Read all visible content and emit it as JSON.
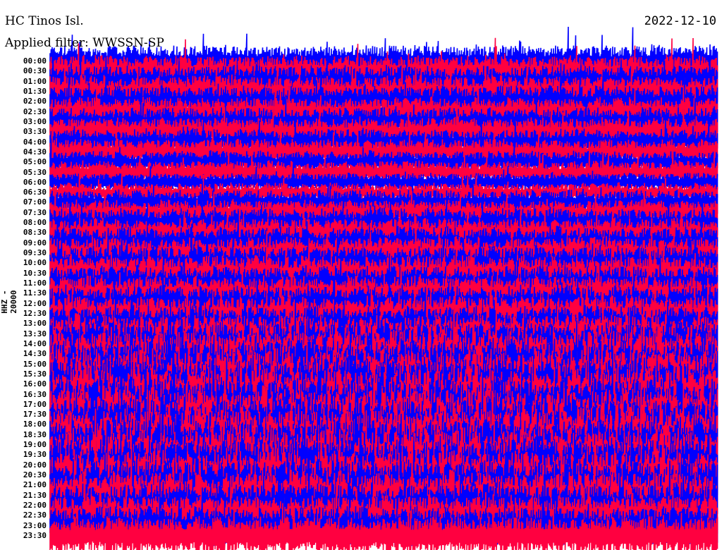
{
  "header": {
    "station": "HC Tinos Isl.",
    "filter": "Applied filter: WWSSN-SP",
    "date": "2022-12-10"
  },
  "chart_data": {
    "type": "line",
    "title": "HC Tinos Isl.",
    "subtitle": "Applied filter: WWSSN-SP",
    "date": "2022-12-10",
    "ylabel": "HHZ - 20000",
    "row_minutes": 30,
    "colors": [
      "#0000ff",
      "#ff0040"
    ],
    "row_labels": [
      "00:00",
      "00:30",
      "01:00",
      "01:30",
      "02:00",
      "02:30",
      "03:00",
      "03:30",
      "04:00",
      "04:30",
      "05:00",
      "05:30",
      "06:00",
      "06:30",
      "07:00",
      "07:30",
      "08:00",
      "08:30",
      "09:00",
      "09:30",
      "10:00",
      "10:30",
      "11:00",
      "11:30",
      "12:00",
      "12:30",
      "13:00",
      "13:30",
      "14:00",
      "14:30",
      "15:00",
      "15:30",
      "16:00",
      "16:30",
      "17:00",
      "17:30",
      "18:00",
      "18:30",
      "19:00",
      "19:30",
      "20:00",
      "20:30",
      "21:00",
      "21:30",
      "22:00",
      "22:30",
      "23:00",
      "23:30"
    ],
    "relative_amplitude": [
      1.0,
      1.0,
      1.0,
      1.0,
      1.0,
      0.9,
      0.9,
      0.9,
      0.8,
      0.8,
      0.7,
      0.7,
      0.6,
      0.6,
      0.8,
      0.8,
      0.9,
      0.9,
      1.0,
      1.0,
      1.1,
      1.1,
      1.1,
      1.1,
      1.1,
      1.1,
      1.1,
      1.2,
      1.4,
      1.5,
      1.6,
      1.6,
      1.7,
      1.7,
      1.7,
      1.7,
      1.7,
      1.7,
      1.7,
      1.7,
      1.7,
      1.6,
      1.6,
      1.5,
      1.4,
      1.3,
      1.2,
      1.2
    ]
  }
}
